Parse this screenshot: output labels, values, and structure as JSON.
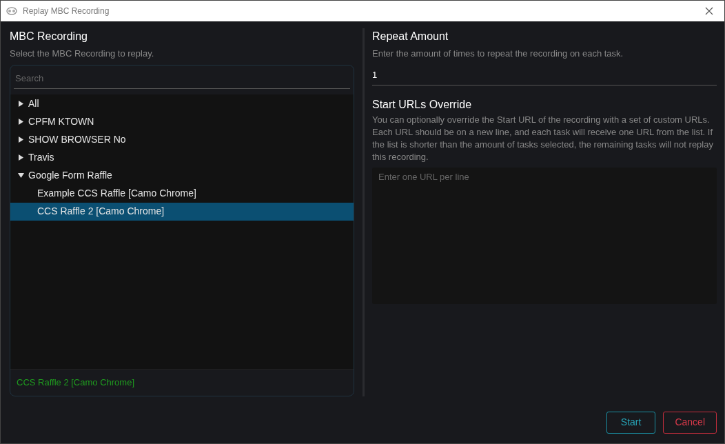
{
  "window": {
    "title": "Replay MBC Recording"
  },
  "recording": {
    "title": "MBC Recording",
    "description": "Select the MBC Recording to replay.",
    "search": {
      "placeholder": "Search"
    },
    "tree": [
      {
        "label": "All",
        "expanded": false,
        "selected": false
      },
      {
        "label": "CPFM KTOWN",
        "expanded": false,
        "selected": false
      },
      {
        "label": "SHOW BROWSER No",
        "expanded": false,
        "selected": false
      },
      {
        "label": "Travis",
        "expanded": false,
        "selected": false
      },
      {
        "label": "Google Form Raffle",
        "expanded": true,
        "selected": false,
        "children": [
          {
            "label": "Example CCS Raffle [Camo Chrome]",
            "selected": false
          },
          {
            "label": "CCS Raffle 2 [Camo Chrome]",
            "selected": true
          }
        ]
      }
    ],
    "selection": "CCS Raffle 2 [Camo Chrome]"
  },
  "repeat": {
    "title": "Repeat Amount",
    "description": "Enter the amount of times to repeat the recording on each task.",
    "value": "1"
  },
  "urls": {
    "title": "Start URLs Override",
    "description": "You can optionally override the Start URL of the recording with a set of custom URLs. Each URL should be on a new line, and each task will receive one URL from the list. If the list is shorter than the amount of tasks selected, the remaining tasks will not replay this recording.",
    "placeholder": "Enter one URL per line"
  },
  "buttons": [
    {
      "label": "Start",
      "kind": "primary"
    },
    {
      "label": "Cancel",
      "kind": "danger"
    }
  ]
}
